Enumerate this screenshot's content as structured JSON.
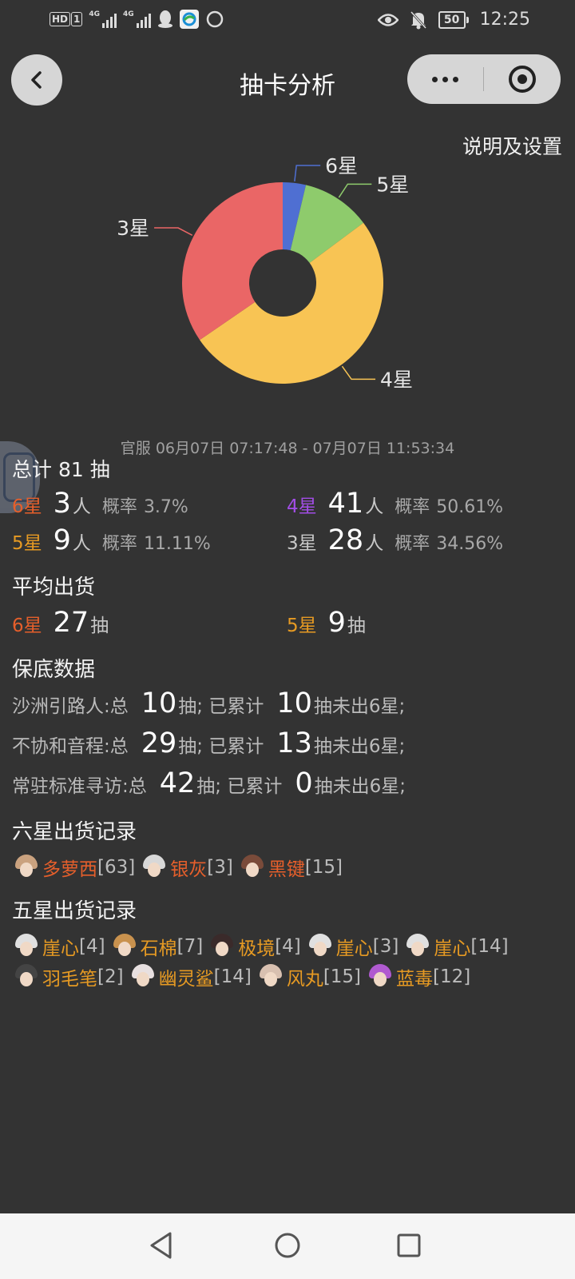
{
  "status": {
    "hd": "HD",
    "sim1": "1",
    "net1": "4G",
    "net2": "4G",
    "battery": "50",
    "time": "12:25"
  },
  "nav": {
    "title": "抽卡分析"
  },
  "settings_label": "说明及设置",
  "chart_data": {
    "type": "pie",
    "style": "donut",
    "categories": [
      "6星",
      "5星",
      "4星",
      "3星"
    ],
    "values": [
      3,
      9,
      41,
      28
    ],
    "colors": [
      "#4f6fd2",
      "#8ecb6c",
      "#f8c454",
      "#ea6666"
    ]
  },
  "date_range": "官服  06月07日 07:17:48  -  07月07日 11:53:34",
  "summary": {
    "total_prefix": "总计",
    "total_value": "81",
    "total_suffix": "抽",
    "unit_person": "人",
    "rate_label": "概率",
    "s6": {
      "label": "6星",
      "count": "3",
      "rate": "3.7%"
    },
    "s4": {
      "label": "4星",
      "count": "41",
      "rate": "50.61%"
    },
    "s5": {
      "label": "5星",
      "count": "9",
      "rate": "11.11%"
    },
    "s3": {
      "label": "3星",
      "count": "28",
      "rate": "34.56%"
    }
  },
  "average": {
    "title": "平均出货",
    "unit": "抽",
    "s6": {
      "label": "6星",
      "value": "27"
    },
    "s5": {
      "label": "5星",
      "value": "9"
    }
  },
  "pity": {
    "title": "保底数据",
    "rows": [
      {
        "pool": "沙洲引路人:总",
        "total": "10",
        "mid": "抽;  已累计",
        "since": "10",
        "tail": "抽未出6星;"
      },
      {
        "pool": "不协和音程:总",
        "total": "29",
        "mid": "抽;  已累计",
        "since": "13",
        "tail": "抽未出6星;"
      },
      {
        "pool": "常驻标准寻访:总",
        "total": "42",
        "mid": "抽;  已累计",
        "since": "0",
        "tail": "抽未出6星;"
      }
    ]
  },
  "six_star": {
    "title": "六星出货记录",
    "items": [
      {
        "name": "多萝西",
        "count": "[63]",
        "hair": "#caa27f"
      },
      {
        "name": "银灰",
        "count": "[3]",
        "hair": "#d8d8d8"
      },
      {
        "name": "黑键",
        "count": "[15]",
        "hair": "#7a4b3a"
      }
    ]
  },
  "five_star": {
    "title": "五星出货记录",
    "items": [
      {
        "name": "崖心",
        "count": "[4]",
        "hair": "#e0e0e0"
      },
      {
        "name": "石棉",
        "count": "[7]",
        "hair": "#c9924e"
      },
      {
        "name": "极境",
        "count": "[4]",
        "hair": "#3a2a2a"
      },
      {
        "name": "崖心",
        "count": "[3]",
        "hair": "#e0e0e0"
      },
      {
        "name": "崖心",
        "count": "[14]",
        "hair": "#e0e0e0"
      },
      {
        "name": "羽毛笔",
        "count": "[2]",
        "hair": "#444444"
      },
      {
        "name": "幽灵鲨",
        "count": "[14]",
        "hair": "#e8e0e0"
      },
      {
        "name": "风丸",
        "count": "[15]",
        "hair": "#d8c0b0"
      },
      {
        "name": "蓝毒",
        "count": "[12]",
        "hair": "#b05ad0"
      }
    ]
  }
}
